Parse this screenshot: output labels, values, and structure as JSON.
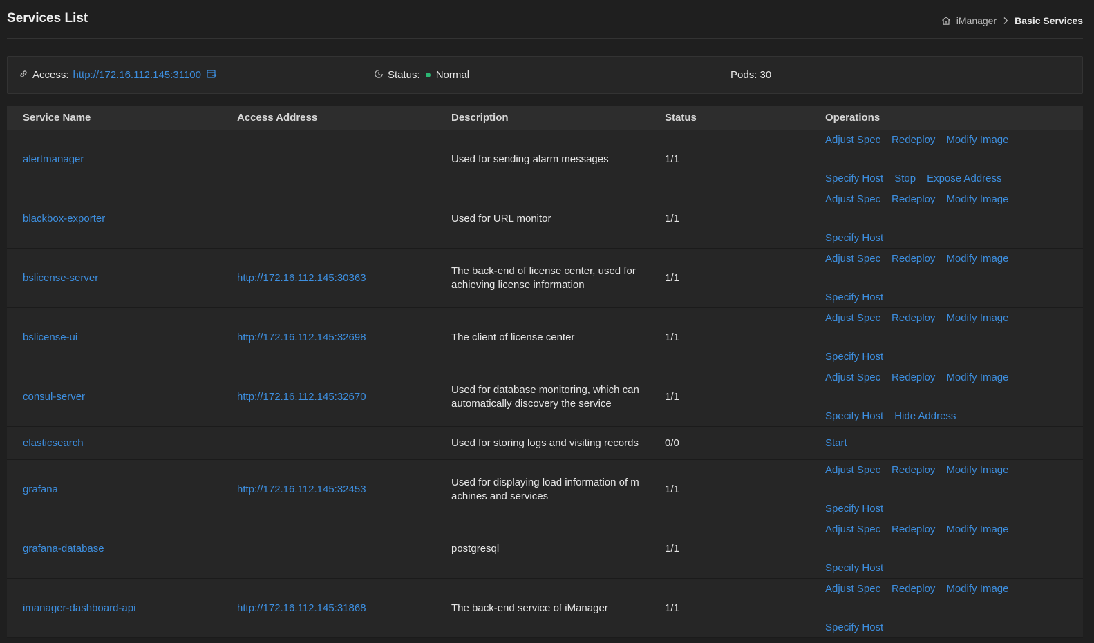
{
  "header": {
    "title": "Services List",
    "breadcrumb": {
      "home": "iManager",
      "separator_icon": "chevron-right-icon",
      "current": "Basic Services"
    }
  },
  "info": {
    "access_label": "Access:",
    "access_url": "http://172.16.112.145:31100",
    "status_label": "Status:",
    "status_value": "Normal",
    "status_color": "#2bb673",
    "pods": "Pods: 30"
  },
  "table": {
    "columns": [
      "Service Name",
      "Access Address",
      "Description",
      "Status",
      "Operations"
    ],
    "rows": [
      {
        "name": "alertmanager",
        "address": "",
        "description": "Used for sending alarm messages",
        "status": "1/1",
        "ops": [
          "Adjust Spec",
          "Redeploy",
          "Modify Image",
          "Specify Host",
          "Stop",
          "Expose Address"
        ]
      },
      {
        "name": "blackbox-exporter",
        "address": "",
        "description": "Used for URL monitor",
        "status": "1/1",
        "ops": [
          "Adjust Spec",
          "Redeploy",
          "Modify Image",
          "Specify Host"
        ]
      },
      {
        "name": "bslicense-server",
        "address": "http://172.16.112.145:30363",
        "description": "The back-end of license center, used for achieving license information",
        "status": "1/1",
        "ops": [
          "Adjust Spec",
          "Redeploy",
          "Modify Image",
          "Specify Host"
        ]
      },
      {
        "name": "bslicense-ui",
        "address": "http://172.16.112.145:32698",
        "description": "The client of license center",
        "status": "1/1",
        "ops": [
          "Adjust Spec",
          "Redeploy",
          "Modify Image",
          "Specify Host"
        ]
      },
      {
        "name": "consul-server",
        "address": "http://172.16.112.145:32670",
        "description": "Used for database monitoring, which can automatically discovery the service",
        "status": "1/1",
        "ops": [
          "Adjust Spec",
          "Redeploy",
          "Modify Image",
          "Specify Host",
          "Hide Address"
        ]
      },
      {
        "name": "elasticsearch",
        "address": "",
        "description": "Used for storing logs and visiting records",
        "status": "0/0",
        "ops": [
          "Start"
        ]
      },
      {
        "name": "grafana",
        "address": "http://172.16.112.145:32453",
        "description": "Used for displaying load information of machines and services",
        "status": "1/1",
        "ops": [
          "Adjust Spec",
          "Redeploy",
          "Modify Image",
          "Specify Host"
        ]
      },
      {
        "name": "grafana-database",
        "address": "",
        "description": "postgresql",
        "status": "1/1",
        "ops": [
          "Adjust Spec",
          "Redeploy",
          "Modify Image",
          "Specify Host"
        ]
      },
      {
        "name": "imanager-dashboard-api",
        "address": "http://172.16.112.145:31868",
        "description": "The back-end service of iManager",
        "status": "1/1",
        "ops": [
          "Adjust Spec",
          "Redeploy",
          "Modify Image",
          "Specify Host"
        ]
      }
    ]
  }
}
